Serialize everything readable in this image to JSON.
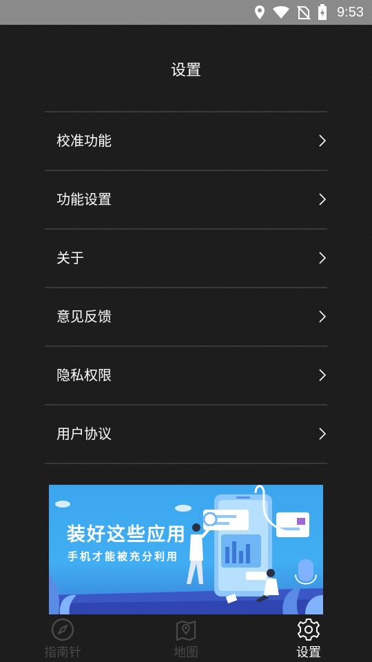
{
  "status_bar": {
    "time": "9:53",
    "icons": [
      "location-icon",
      "wifi-icon",
      "no-sim-icon",
      "battery-charging-icon"
    ]
  },
  "page": {
    "title": "设置"
  },
  "menu": {
    "items": [
      {
        "label": "校准功能",
        "icon": "chevron-right-icon"
      },
      {
        "label": "功能设置",
        "icon": "chevron-right-icon"
      },
      {
        "label": "关于",
        "icon": "chevron-right-icon"
      },
      {
        "label": "意见反馈",
        "icon": "chevron-right-icon"
      },
      {
        "label": "隐私权限",
        "icon": "chevron-right-icon"
      },
      {
        "label": "用户协议",
        "icon": "chevron-right-icon"
      }
    ]
  },
  "banner": {
    "title": "装好这些应用",
    "subtitle": "手机才能被充分利用",
    "accent_color": "#3ba6ee"
  },
  "bottom_nav": {
    "items": [
      {
        "label": "指南针",
        "icon": "compass-icon",
        "active": false
      },
      {
        "label": "地图",
        "icon": "map-icon",
        "active": false
      },
      {
        "label": "设置",
        "icon": "gear-icon",
        "active": true
      }
    ]
  },
  "colors": {
    "background": "#1c1c1c",
    "status_bar": "#8a8a8a",
    "divider": "#3a3a3a",
    "text_primary": "#ffffff",
    "nav_inactive": "#4a4a4a"
  }
}
